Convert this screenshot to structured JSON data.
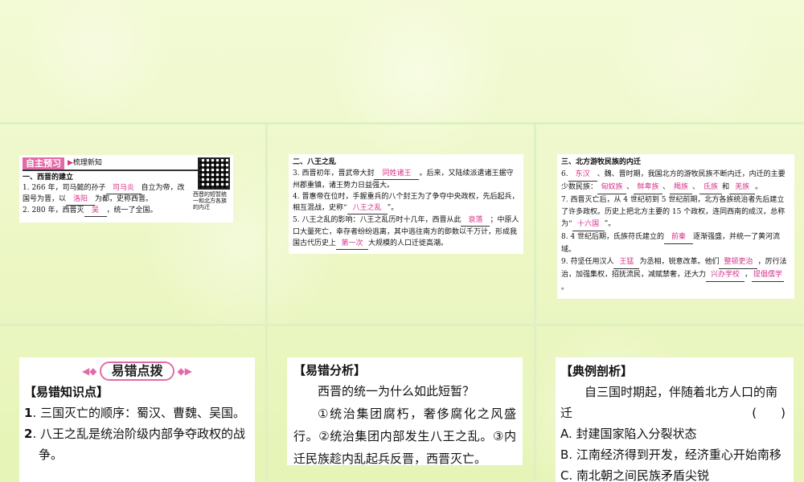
{
  "card1": {
    "header_box": "自主预习",
    "header_sub": "梳理新知",
    "section": "一、西晋的建立",
    "qr_caption": "西晋的短暂统一和北方各族的内迁",
    "q1_pre": "1. 266 年，司马懿的孙子",
    "q1_a1": "司马炎",
    "q1_mid": "自立为帝，改国号为晋，以",
    "q1_a2": "洛阳",
    "q1_post": "为都，史称西晋。",
    "q2_pre": "2. 280 年，西晋灭",
    "q2_a": "吴",
    "q2_post": "，统一了全国。"
  },
  "card2": {
    "section": "二、八王之乱",
    "q3_pre": "3. 西晋初年，晋武帝大封",
    "q3_a": "同姓诸王",
    "q3_post": "。后来，又陆续派遣诸王据守州郡重镇，诸王势力日益强大。",
    "q4_pre": "4. 晋惠帝在位时，手握重兵的八个封王为了争夺中央政权，先后起兵，相互混战，史称“",
    "q4_a": "八王之乱",
    "q4_post": "”。",
    "q5_pre": "5. 八王之乱的影响：八王之乱历时十几年，西晋从此",
    "q5_a1": "衰落",
    "q5_mid": "；中原人口大量死亡，幸存者纷纷逃离，其中逃往南方的即数以千万计，形成我国古代历史上",
    "q5_a2": "第一次",
    "q5_post": "大规模的人口迁徙高潮。"
  },
  "card3": {
    "section": "三、北方游牧民族的内迁",
    "q6_pre": "6.",
    "q6_a1": "东汉",
    "q6_mid": "、魏、晋时期，我国北方的游牧民族不断内迁，内迁的主要少数民族：",
    "q6_a2": "匈奴族",
    "q6_a3": "鲜卑族",
    "q6_a4": "羯族",
    "q6_a5": "氐族",
    "q6_and": "和",
    "q6_a6": "羌族",
    "q6_post": "。",
    "q7_pre": "7. 西晋灭亡后，从 4 世纪初到 5 世纪前期，北方各族统治者先后建立了许多政权。历史上把北方主要的 15 个政权，连同西南的成汉，总称为“",
    "q7_a": "十六国",
    "q7_post": "”。",
    "q8_pre": "8. 4 世纪后期，氐族苻氏建立的",
    "q8_a": "前秦",
    "q8_post": "逐渐强盛，并统一了黄河流域。",
    "q9_pre": "9. 苻坚任用汉人",
    "q9_a1": "王猛",
    "q9_mid1": "为丞相，锐意改革。他们",
    "q9_a2": "整顿吏治",
    "q9_mid2": "，厉行法治，加强集权，招抚流民，减赋禁奢，还大力",
    "q9_a3": "兴办学校",
    "q9_mid3": "，",
    "q9_a4": "提倡儒学",
    "q9_post": "。"
  },
  "card4": {
    "banner": "易错点拨",
    "knowledge_header": "【易错知识点】",
    "item1_num": "1",
    "item1": ". 三国灭亡的顺序：蜀汉、曹魏、吴国。",
    "item2_num": "2",
    "item2": ". 八王之乱是统治阶级内部争夺政权的战争。"
  },
  "card5": {
    "header": "【易错分析】",
    "question": "西晋的统一为什么如此短暂？",
    "answer": "①统治集团腐朽，奢侈腐化之风盛行。②统治集团内部发生八王之乱。③内迁民族趁内乱起兵反晋，西晋灭亡。"
  },
  "card6": {
    "header": "【典例剖析】",
    "question": "自三国时期起，伴随着北方人口的南迁",
    "bracket": "(　　)",
    "optA": "A. 封建国家陷入分裂状态",
    "optB": "B. 江南经济得到开发，经济重心开始南移",
    "optC": "C. 南北朝之间民族矛盾尖锐"
  }
}
